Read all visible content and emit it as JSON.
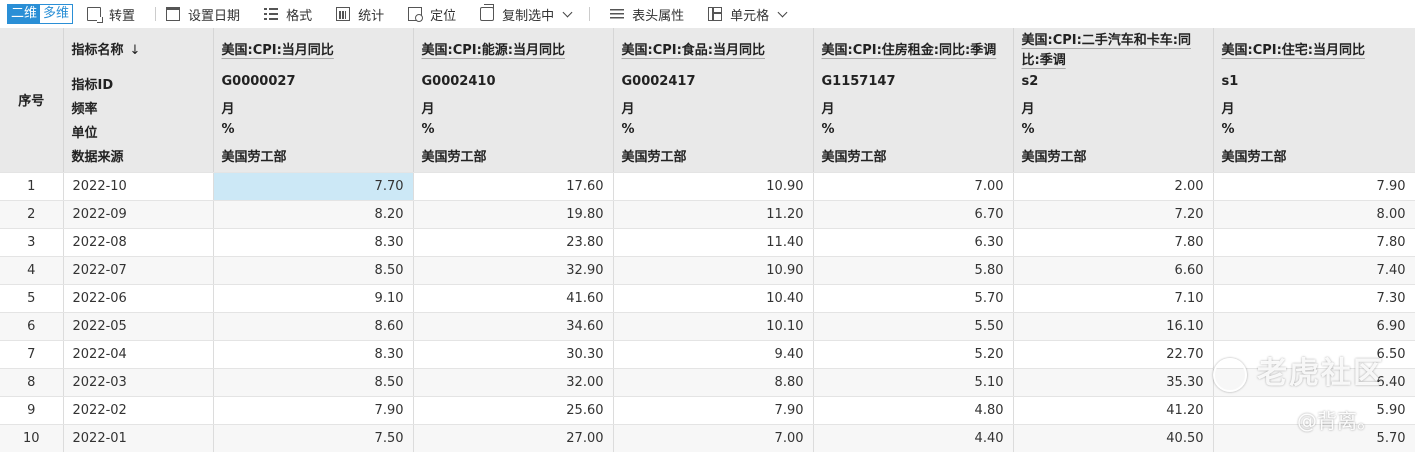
{
  "toolbar": {
    "mode_2d": "二维",
    "mode_multi": "多维",
    "transpose": "转置",
    "set_date": "设置日期",
    "format": "格式",
    "stats": "统计",
    "locate": "定位",
    "copy_selection": "复制选中",
    "header_props": "表头属性",
    "cell": "单元格"
  },
  "header": {
    "index_label": "序号",
    "row_labels": {
      "name": "指标名称",
      "id": "指标ID",
      "frequency": "频率",
      "unit": "单位",
      "source": "数据来源"
    },
    "sort_arrow": "↓",
    "columns": [
      {
        "name": "美国:CPI:当月同比",
        "id": "G0000027",
        "frequency": "月",
        "unit": "%",
        "source": "美国劳工部"
      },
      {
        "name": "美国:CPI:能源:当月同比",
        "id": "G0002410",
        "frequency": "月",
        "unit": "%",
        "source": "美国劳工部"
      },
      {
        "name": "美国:CPI:食品:当月同比",
        "id": "G0002417",
        "frequency": "月",
        "unit": "%",
        "source": "美国劳工部"
      },
      {
        "name": "美国:CPI:住房租金:同比:季调",
        "id": "G1157147",
        "frequency": "月",
        "unit": "%",
        "source": "美国劳工部"
      },
      {
        "name": "美国:CPI:二手汽车和卡车:同比:季调",
        "id": "s2",
        "frequency": "月",
        "unit": "%",
        "source": "美国劳工部"
      },
      {
        "name": "美国:CPI:住宅:当月同比",
        "id": "s1",
        "frequency": "月",
        "unit": "%",
        "source": "美国劳工部"
      }
    ]
  },
  "rows": [
    {
      "idx": "1",
      "date": "2022-10",
      "values": [
        "7.70",
        "17.60",
        "10.90",
        "7.00",
        "2.00",
        "7.90"
      ]
    },
    {
      "idx": "2",
      "date": "2022-09",
      "values": [
        "8.20",
        "19.80",
        "11.20",
        "6.70",
        "7.20",
        "8.00"
      ]
    },
    {
      "idx": "3",
      "date": "2022-08",
      "values": [
        "8.30",
        "23.80",
        "11.40",
        "6.30",
        "7.80",
        "7.80"
      ]
    },
    {
      "idx": "4",
      "date": "2022-07",
      "values": [
        "8.50",
        "32.90",
        "10.90",
        "5.80",
        "6.60",
        "7.40"
      ]
    },
    {
      "idx": "5",
      "date": "2022-06",
      "values": [
        "9.10",
        "41.60",
        "10.40",
        "5.70",
        "7.10",
        "7.30"
      ]
    },
    {
      "idx": "6",
      "date": "2022-05",
      "values": [
        "8.60",
        "34.60",
        "10.10",
        "5.50",
        "16.10",
        "6.90"
      ]
    },
    {
      "idx": "7",
      "date": "2022-04",
      "values": [
        "8.30",
        "30.30",
        "9.40",
        "5.20",
        "22.70",
        "6.50"
      ]
    },
    {
      "idx": "8",
      "date": "2022-03",
      "values": [
        "8.50",
        "32.00",
        "8.80",
        "5.10",
        "35.30",
        "6.40"
      ]
    },
    {
      "idx": "9",
      "date": "2022-02",
      "values": [
        "7.90",
        "25.60",
        "7.90",
        "4.80",
        "41.20",
        "5.90"
      ]
    },
    {
      "idx": "10",
      "date": "2022-01",
      "values": [
        "7.50",
        "27.00",
        "7.00",
        "4.40",
        "40.50",
        "5.70"
      ]
    }
  ],
  "watermark": {
    "main": "老虎社区",
    "sub": "@背离。"
  },
  "colors": {
    "accent": "#2a8fd6",
    "selected_cell": "#cce8f6",
    "header_bg": "#e9e9e9"
  }
}
